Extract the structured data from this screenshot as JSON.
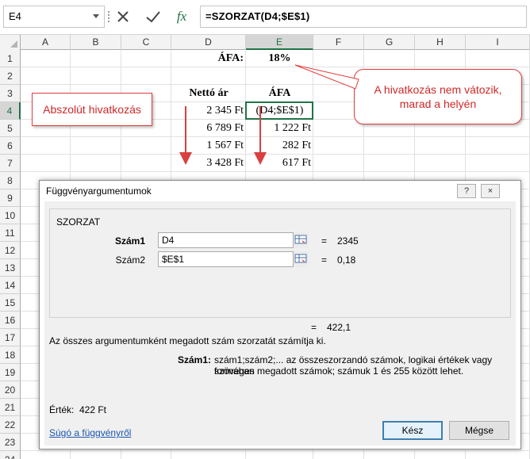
{
  "formula_bar": {
    "name_box": "E4",
    "formula": "=SZORZAT(D4;$E$1)",
    "icons": [
      "cancel-icon",
      "enter-icon",
      "function-icon"
    ],
    "fx_label": "fx"
  },
  "grid": {
    "columns": [
      "A",
      "B",
      "C",
      "D",
      "E",
      "F",
      "G",
      "H",
      "I"
    ],
    "rows": [
      "1",
      "2",
      "3",
      "4",
      "5",
      "6",
      "7",
      "8",
      "9",
      "10",
      "11",
      "12",
      "13",
      "14",
      "15",
      "16",
      "17",
      "18",
      "19",
      "20",
      "21",
      "22",
      "23",
      "24"
    ],
    "selected_column": "E",
    "selected_row": "4",
    "cells": {
      "D1": "ÁFA:",
      "E1": "18%",
      "D3": "Nettó ár",
      "E3": "ÁFA",
      "D4": "2 345 Ft",
      "E4": "(D4;$E$1)",
      "D5": "6 789 Ft",
      "E5": "1 222 Ft",
      "D6": "1 567 Ft",
      "E6": "282 Ft",
      "D7": "3 428 Ft",
      "E7": "617 Ft"
    },
    "arrow_color": "#d94040"
  },
  "callouts": {
    "left": "Abszolút hivatkozás",
    "right_line1": "A hivatkozás nem vátozik,",
    "right_line2": "marad a helyén",
    "color": "#e33b3b"
  },
  "dialog": {
    "title": "Függvényargumentumok",
    "titlebar_buttons": [
      "?",
      "×"
    ],
    "function_name": "SZORZAT",
    "args": [
      {
        "label": "Szám1",
        "value": "D4",
        "result": "2345",
        "bold": true
      },
      {
        "label": "Szám2",
        "value": "$E$1",
        "result": "0,18",
        "bold": false
      }
    ],
    "equals": "=",
    "total_result": "422,1",
    "description": "Az összes argumentumként megadott szám szorzatát számítja ki.",
    "arg_desc_label": "Szám1:",
    "arg_desc_line1": "szám1;szám2;... az összeszorzandó számok, logikai értékek vagy szöveges",
    "arg_desc_line2": "formában megadott számok; számuk 1 és 255 között lehet.",
    "result_label": "Érték:",
    "result_value": "422 Ft",
    "help_link": "Súgó a függvényről",
    "ok_label": "Kész",
    "cancel_label": "Mégse"
  }
}
